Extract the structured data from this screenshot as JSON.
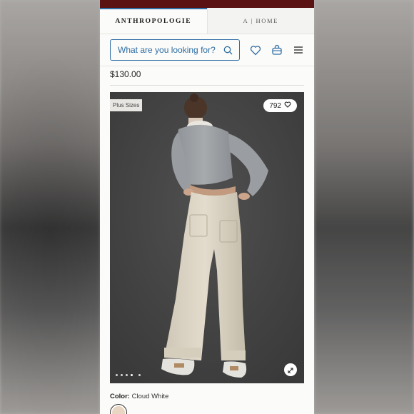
{
  "tabs": {
    "brand": "ANTHROPOLOGIE",
    "home": "A | HOME"
  },
  "search": {
    "placeholder": "What are you looking for?"
  },
  "product": {
    "price": "$130.00",
    "badge": "Plus Sizes",
    "likes": "792",
    "image_dots": 5,
    "active_dot": 3,
    "color_label": "Color:",
    "color_value": "Cloud White"
  },
  "colors": {
    "accent": "#2e6da4",
    "topbar": "#5a1212",
    "swatch": "#e8d5c2"
  },
  "icons": [
    "search-icon",
    "heart-icon",
    "bag-icon",
    "menu-icon",
    "heart-small-icon",
    "expand-icon"
  ]
}
